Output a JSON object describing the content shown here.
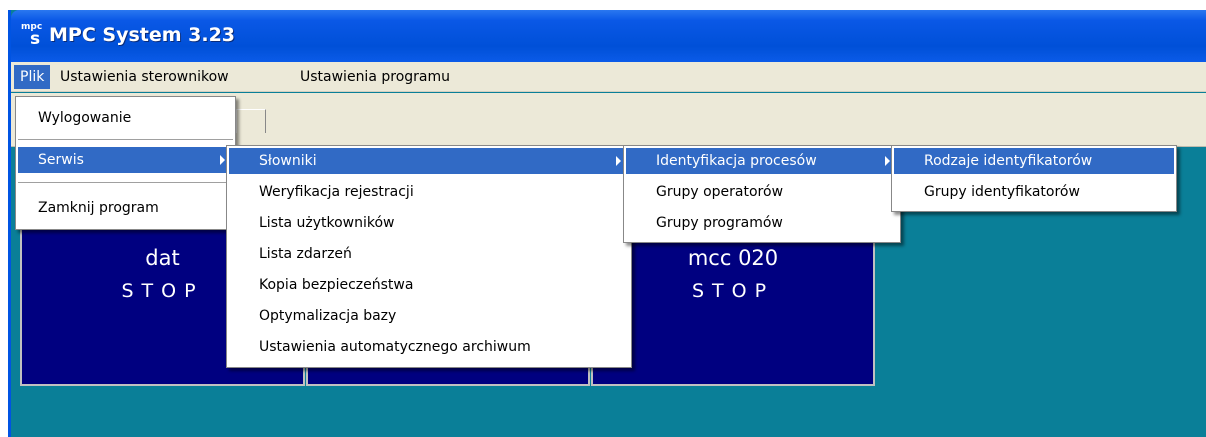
{
  "app": {
    "title": "MPC System 3.23",
    "icon": "mpcs-app-icon"
  },
  "menubar": {
    "items": [
      "Plik",
      "Ustawienia sterownikow",
      "Ustawienia programu"
    ],
    "active": "Plik"
  },
  "plik_menu": {
    "items": [
      "Wylogowanie",
      "Serwis",
      "Zamknij program"
    ],
    "highlighted": "Serwis"
  },
  "serwis_menu": {
    "items": [
      "Słowniki",
      "Weryfikacja rejestracji",
      "Lista użytkowników",
      "Lista zdarzeń",
      "Kopia bezpieczeństwa",
      "Optymalizacja bazy",
      "Ustawienia automatycznego archiwum"
    ],
    "highlighted": "Słowniki"
  },
  "slowniki_menu": {
    "items": [
      "Identyfikacja procesów",
      "Grupy operatorów",
      "Grupy programów"
    ],
    "highlighted": "Identyfikacja procesów"
  },
  "identyfikacja_menu": {
    "items": [
      "Rodzaje identyfikatorów",
      "Grupy identyfikatorów"
    ],
    "highlighted": "Rodzaje identyfikatorów"
  },
  "tiles": [
    {
      "name": "dat",
      "status": "STOP"
    },
    {
      "name": "mcc 020",
      "status": "STOP"
    }
  ],
  "colors": {
    "titlebar": "#0050d8",
    "menu_highlight": "#316ac5",
    "client_bg": "#0a7f98",
    "tile_bg": "#000080"
  }
}
